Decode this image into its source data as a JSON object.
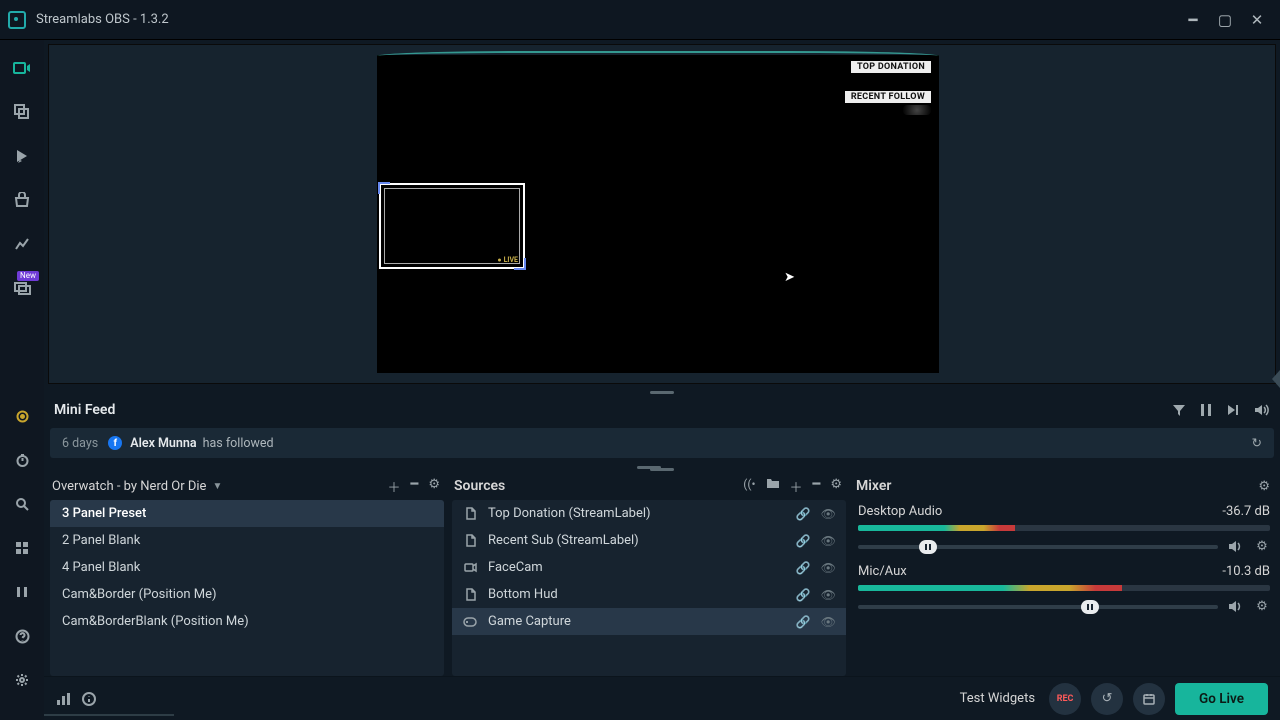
{
  "title": "Streamlabs OBS - 1.3.2",
  "preview": {
    "label_top_donation": "TOP DONATION",
    "label_recent_follow": "RECENT FOLLOW",
    "live_tag": "LIVE"
  },
  "minifeed": {
    "title": "Mini Feed",
    "entry": {
      "time": "6 days",
      "name": "Alex Munna",
      "action": "has followed"
    }
  },
  "scenes": {
    "collection": "Overwatch - by Nerd Or Die",
    "items": [
      "3 Panel Preset",
      "2 Panel Blank",
      "4 Panel Blank",
      "Cam&Border (Position Me)",
      "Cam&BorderBlank (Position Me)"
    ],
    "selected": 0
  },
  "sources": {
    "title": "Sources",
    "items": [
      {
        "icon": "doc",
        "label": "Top Donation (StreamLabel)"
      },
      {
        "icon": "doc",
        "label": "Recent Sub (StreamLabel)"
      },
      {
        "icon": "cam",
        "label": "FaceCam"
      },
      {
        "icon": "doc",
        "label": "Bottom Hud"
      },
      {
        "icon": "game",
        "label": "Game Capture",
        "selected": true
      }
    ]
  },
  "mixer": {
    "title": "Mixer",
    "channels": [
      {
        "name": "Desktop Audio",
        "db": "-36.7 dB",
        "meter": 38,
        "slider": 17
      },
      {
        "name": "Mic/Aux",
        "db": "-10.3 dB",
        "meter": 64,
        "slider": 62
      }
    ]
  },
  "bottom": {
    "test_widgets": "Test Widgets",
    "go_live": "Go Live",
    "rec": "REC"
  }
}
